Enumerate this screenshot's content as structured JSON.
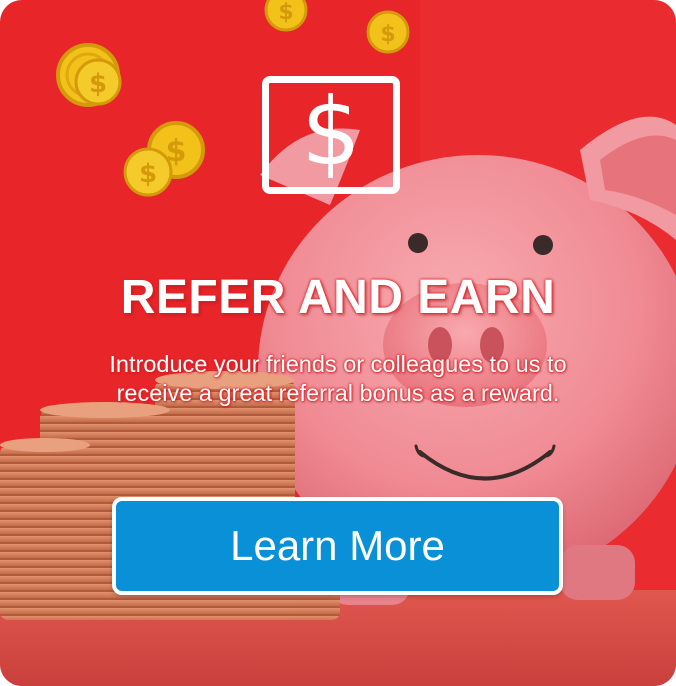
{
  "promo": {
    "icon": "dollar-sign-icon",
    "dollar_glyph": "$",
    "title": "REFER AND EARN",
    "description": "Introduce your friends or colleagues to us to receive a great referral bonus as a reward.",
    "cta_label": "Learn More"
  },
  "colors": {
    "background_red": "#e8262a",
    "button_blue": "#0a90d6",
    "piggy_pink": "#f08a93",
    "coin_gold": "#f2c21b",
    "copper_coins": "#c9714e"
  }
}
